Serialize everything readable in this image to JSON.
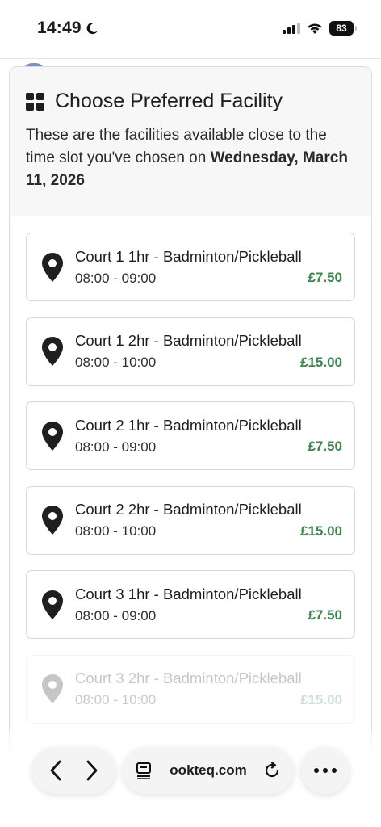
{
  "status_bar": {
    "time": "14:49",
    "battery": "83",
    "icons": [
      "moon-icon",
      "signal-icon",
      "wifi-icon",
      "battery-icon"
    ]
  },
  "modal": {
    "title": "Choose Preferred Facility",
    "subtitle_prefix": "These are the facilities available close to the time slot you've chosen on ",
    "subtitle_date": "Wednesday, March 11, 2026",
    "icon": "grid-icon"
  },
  "facilities": [
    {
      "name": "Court 1 1hr - Badminton/Pickleball",
      "time": "08:00 - 09:00",
      "price": "£7.50"
    },
    {
      "name": "Court 1 2hr - Badminton/Pickleball",
      "time": "08:00 - 10:00",
      "price": "£15.00"
    },
    {
      "name": "Court 2 1hr - Badminton/Pickleball",
      "time": "08:00 - 09:00",
      "price": "£7.50"
    },
    {
      "name": "Court 2 2hr - Badminton/Pickleball",
      "time": "08:00 - 10:00",
      "price": "£15.00"
    },
    {
      "name": "Court 3 1hr - Badminton/Pickleball",
      "time": "08:00 - 09:00",
      "price": "£7.50"
    },
    {
      "name": "Court 3 2hr - Badminton/Pickleball",
      "time": "08:00 - 10:00",
      "price": "£15.00"
    }
  ],
  "toolbar": {
    "url": "ookteq.com"
  },
  "colors": {
    "price": "#3a8a4e",
    "header_bg": "#f7f7f7",
    "border": "#d8d8d8"
  }
}
